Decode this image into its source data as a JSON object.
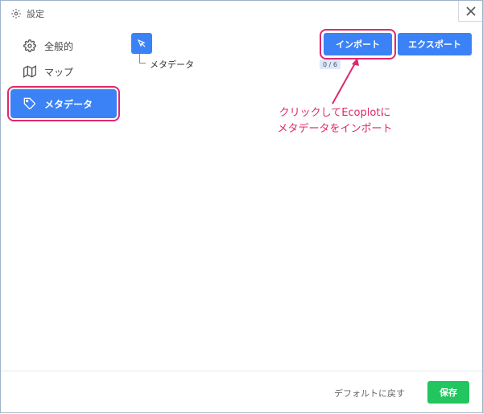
{
  "window": {
    "title": "設定",
    "title_icon": "gear-icon",
    "close_icon": "close-icon"
  },
  "sidebar": {
    "items": [
      {
        "label": "全般的",
        "icon": "gear-icon",
        "active": false
      },
      {
        "label": "マップ",
        "icon": "map-icon",
        "active": false
      },
      {
        "label": "メタデータ",
        "icon": "tag-icon",
        "active": true
      }
    ]
  },
  "content": {
    "tree_label": "メタデータ",
    "count": "0 / 6",
    "import_label": "インポート",
    "export_label": "エクスポート"
  },
  "annotation": {
    "line1": "クリックしてEcoplotに",
    "line2": "メタデータをインポート"
  },
  "footer": {
    "reset_label": "デフォルトに戻す",
    "save_label": "保存"
  },
  "colors": {
    "accent": "#3b82f6",
    "highlight": "#e0286d",
    "save": "#22c55e"
  }
}
